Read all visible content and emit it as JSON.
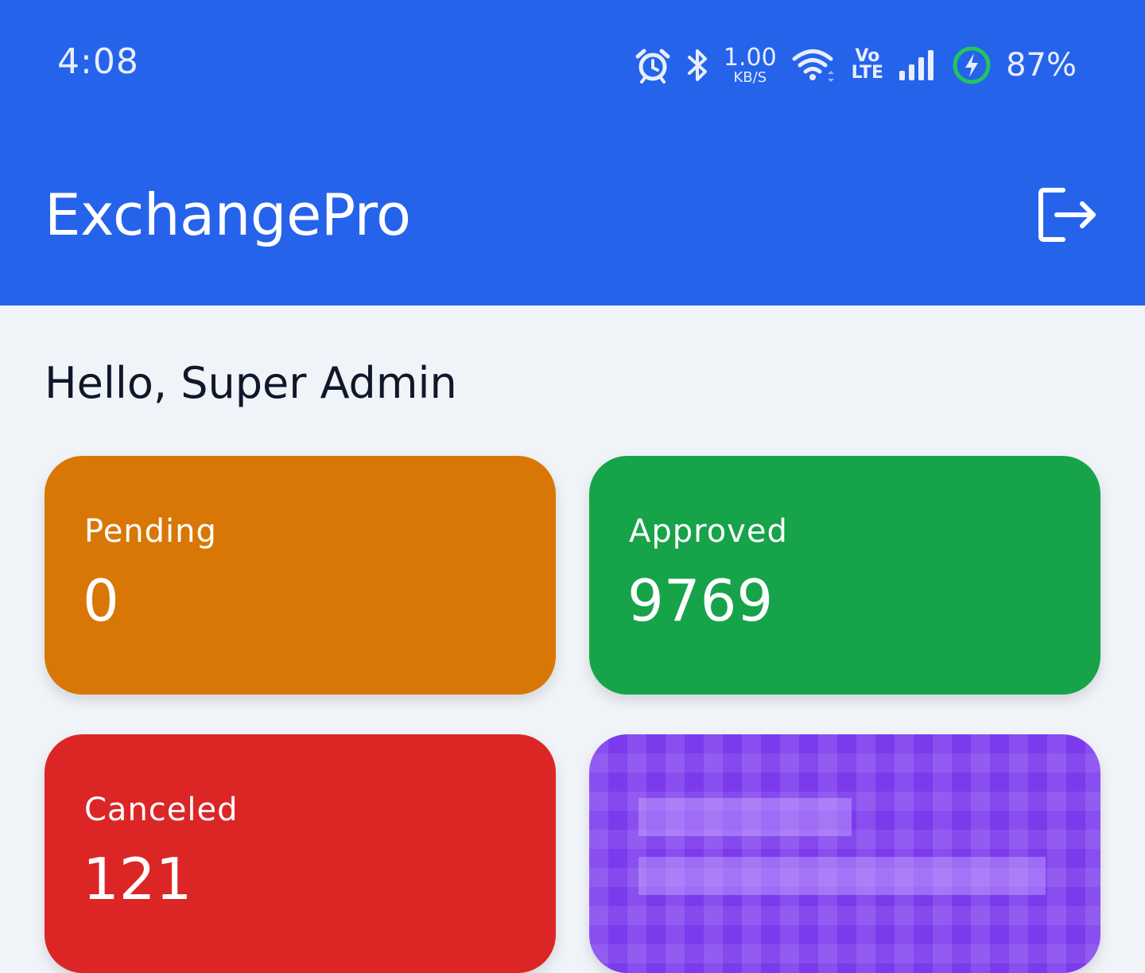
{
  "status_bar": {
    "time": "4:08",
    "net_speed_value": "1.00",
    "net_speed_unit": "KB/S",
    "volte_top": "Vo",
    "volte_bottom": "LTE",
    "battery_percent": "87%",
    "icons": [
      "alarm-icon",
      "bluetooth-icon",
      "wifi-icon",
      "signal-icon",
      "battery-charging-icon"
    ]
  },
  "app_bar": {
    "title": "ExchangePro",
    "logout_icon": "logout-icon",
    "background": "#2563eb"
  },
  "greeting": "Hello, Super Admin",
  "cards": [
    {
      "label": "Pending",
      "value": "0",
      "color": "#d97706"
    },
    {
      "label": "Approved",
      "value": "9769",
      "color": "#16a34a"
    },
    {
      "label": "Canceled",
      "value": "121",
      "color": "#dc2626"
    },
    {
      "label": "",
      "value": "",
      "color": "#7c3aed",
      "redacted": true
    }
  ]
}
